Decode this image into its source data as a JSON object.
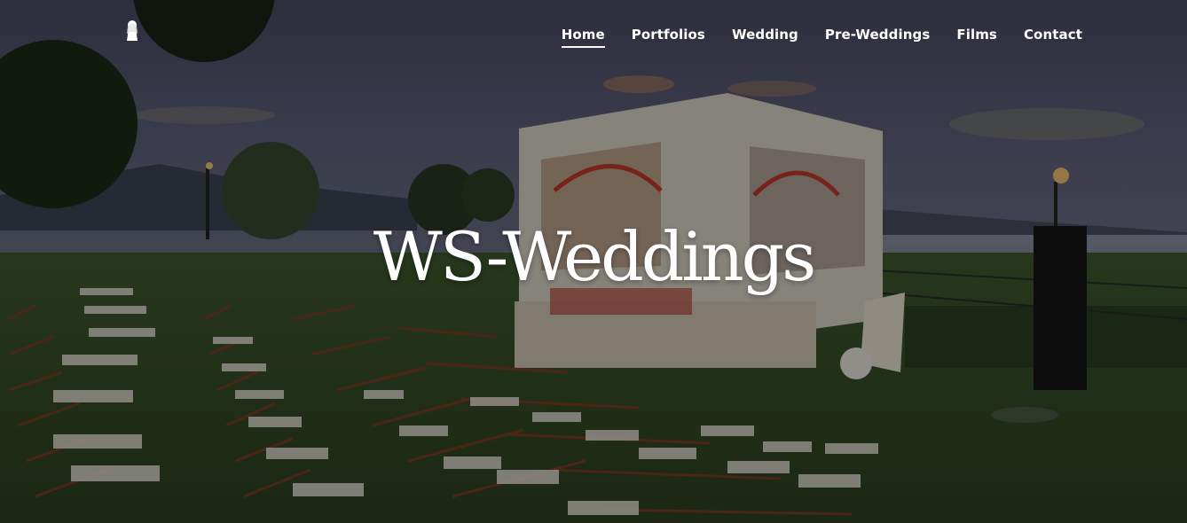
{
  "site": {
    "hero_title": "WS-Weddings",
    "logo_icon": "bride-silhouette-icon"
  },
  "nav": {
    "items": [
      {
        "label": "Home",
        "active": true
      },
      {
        "label": "Portfolios",
        "active": false
      },
      {
        "label": "Wedding",
        "active": false
      },
      {
        "label": "Pre-Weddings",
        "active": false
      },
      {
        "label": "Films",
        "active": false
      },
      {
        "label": "Contact",
        "active": false
      }
    ]
  },
  "colors": {
    "nav_text": "#ffffff",
    "title_text": "#ffffff",
    "overlay": "#000000"
  }
}
